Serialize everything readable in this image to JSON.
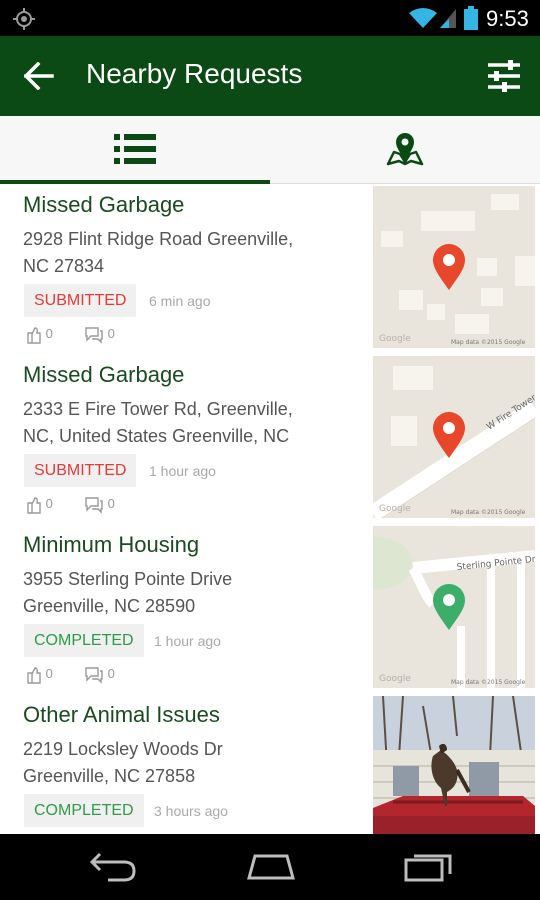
{
  "status_bar": {
    "time": "9:53",
    "icons": [
      "location-icon",
      "wifi-icon",
      "signal-icon",
      "battery-icon"
    ]
  },
  "app_bar": {
    "title": "Nearby Requests",
    "back_icon": "arrow-back-icon",
    "filter_icon": "sliders-icon"
  },
  "tabs": [
    {
      "name": "list",
      "icon": "list-icon",
      "selected": true
    },
    {
      "name": "map",
      "icon": "map-pin-icon",
      "selected": false
    }
  ],
  "requests": [
    {
      "title": "Missed Garbage",
      "address_line1": "2928 Flint Ridge Road Greenville,",
      "address_line2": "NC 27834",
      "status": "SUBMITTED",
      "time_ago": "6 min ago",
      "votes": "0",
      "comments": "0",
      "thumb_credit_left": "Google",
      "thumb_credit_right": "Map data ©2015 Google",
      "pin_color": "#e8472c"
    },
    {
      "title": "Missed Garbage",
      "address_line1": "2333 E Fire Tower Rd, Greenville,",
      "address_line2": "NC, United States Greenville, NC",
      "status": "SUBMITTED",
      "time_ago": "1 hour ago",
      "votes": "0",
      "comments": "0",
      "thumb_street": "W Fire Tower",
      "thumb_credit_left": "Google",
      "thumb_credit_right": "Map data ©2015 Google",
      "pin_color": "#e8472c"
    },
    {
      "title": "Minimum Housing",
      "address_line1": "3955 Sterling Pointe Drive",
      "address_line2": "Greenville, NC 28590",
      "status": "COMPLETED",
      "time_ago": "1 hour ago",
      "votes": "0",
      "comments": "0",
      "thumb_street": "Sterling Pointe Dr",
      "thumb_credit_left": "Google",
      "thumb_credit_right": "Map data ©2015 Google",
      "pin_color": "#3dae6a"
    },
    {
      "title": "Other Animal Issues",
      "address_line1": "2219 Locksley Woods Dr",
      "address_line2": "Greenville, NC 27858",
      "status": "COMPLETED",
      "time_ago": "3 hours ago"
    }
  ],
  "colors": {
    "app_bar": "#0b4a14",
    "submitted": "#e53935",
    "completed": "#2e9c4a",
    "title_text": "#1a4b20"
  }
}
